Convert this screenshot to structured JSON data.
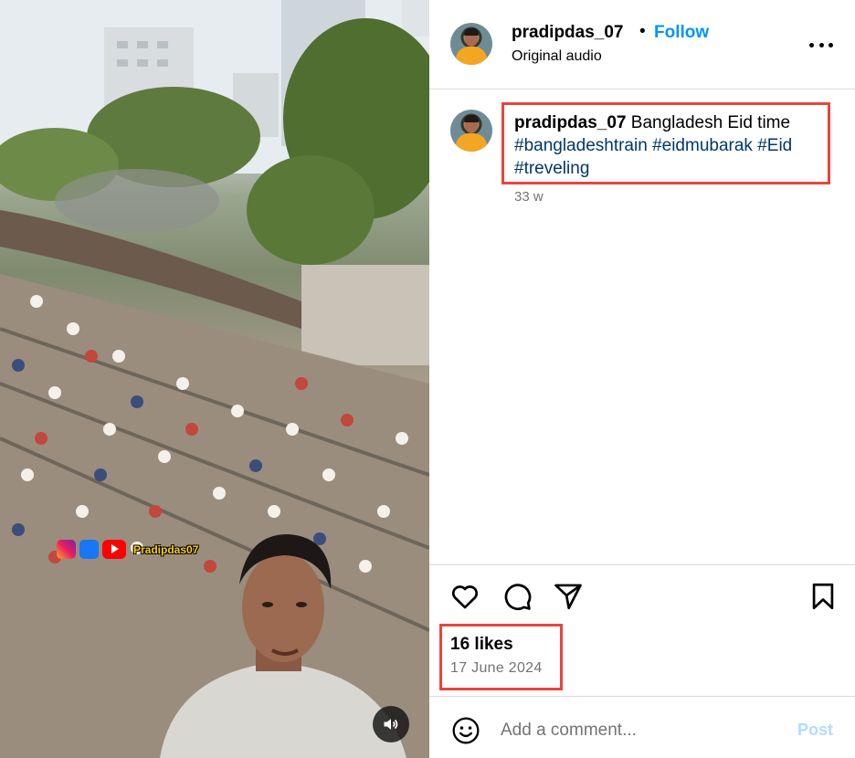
{
  "post": {
    "username": "pradipdas_07",
    "separator": "•",
    "follow_label": "Follow",
    "audio_label": "Original audio",
    "more_icon": "more-horizontal-icon"
  },
  "caption": {
    "username": "pradipdas_07",
    "text": "Bangladesh Eid time",
    "hashtags": [
      "#bangladeshtrain",
      "#eidmubarak",
      "#Eid",
      "#treveling"
    ],
    "time_ago": "33 w"
  },
  "media": {
    "watermark_text": "Pradipdas07",
    "audio_icon": "volume-icon"
  },
  "actions": {
    "like_icon": "heart-icon",
    "comment_icon": "comment-icon",
    "share_icon": "send-icon",
    "save_icon": "bookmark-icon"
  },
  "stats": {
    "likes": "16 likes",
    "date": "17 June 2024"
  },
  "comment": {
    "placeholder": "Add a comment...",
    "post_label": "Post",
    "emoji_icon": "emoji-icon"
  },
  "colors": {
    "accent": "#0095f6",
    "hashtag": "#00376b",
    "highlight_box": "#e8453c",
    "post_disabled": "#b3dbff",
    "muted": "#737373"
  }
}
